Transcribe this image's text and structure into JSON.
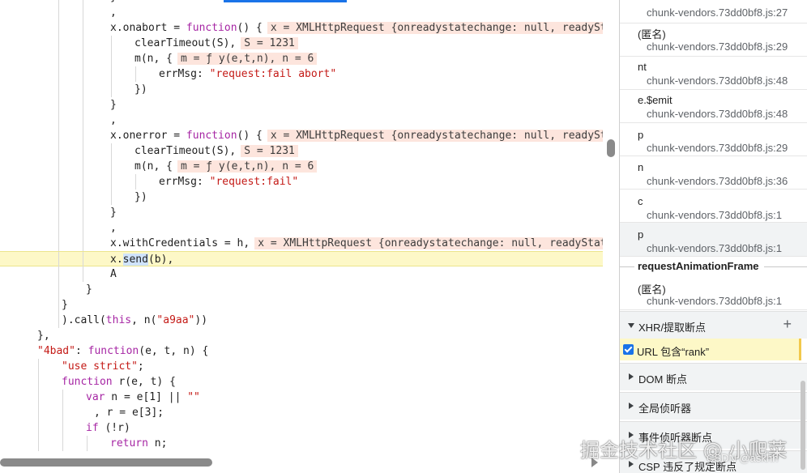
{
  "code": {
    "l0": [
      "}"
    ],
    "l1": [
      ","
    ],
    "l2": [
      "x.onabort = ",
      "function",
      "() {",
      "x = XMLHttpRequest {onreadystatechange: null, readyState"
    ],
    "l3": [
      "clearTimeout(S),",
      "S = 1231"
    ],
    "l4": [
      "m(n, {",
      "m = ƒ y(e,t,n), n = 6"
    ],
    "l5": [
      "errMsg: ",
      "\"request:fail abort\""
    ],
    "l6": [
      "})"
    ],
    "l7": [
      "}"
    ],
    "l8": [
      ","
    ],
    "l9": [
      "x.onerror = ",
      "function",
      "() {",
      "x = XMLHttpRequest {onreadystatechange: null, readyState"
    ],
    "l10": [
      "clearTimeout(S),",
      "S = 1231"
    ],
    "l11": [
      "m(n, {",
      "m = ƒ y(e,t,n), n = 6"
    ],
    "l12": [
      "errMsg: ",
      "\"request:fail\""
    ],
    "l13": [
      "})"
    ],
    "l14": [
      "}"
    ],
    "l15": [
      ","
    ],
    "l16": [
      "x.withCredentials = h,",
      "x = XMLHttpRequest {onreadystatechange: null, readyState:"
    ],
    "l17": [
      "x.",
      "send",
      "(b),"
    ],
    "l18": [
      "A"
    ],
    "l19": [
      "}"
    ],
    "l20": [
      "}"
    ],
    "l21": [
      ").call(",
      "this",
      ", n(",
      "\"a9aa\"",
      "))"
    ],
    "l22": [
      "},"
    ],
    "l23": [
      "\"4bad\"",
      ": ",
      "function",
      "(e, t, n) {"
    ],
    "l24": [
      "\"use strict\"",
      ";"
    ],
    "l25": [
      "function",
      " r(e, t) {"
    ],
    "l26": [
      "var",
      " n = e[1] || ",
      "\"\""
    ],
    "l27": [
      ", r = e[3];"
    ],
    "l28": [
      "if",
      " (!r)"
    ],
    "l29": [
      "return",
      " n;"
    ]
  },
  "call_stack": [
    {
      "name": "",
      "loc": "chunk-vendors.73dd0bf8.js:27"
    },
    {
      "name": "(匿名)",
      "loc": "chunk-vendors.73dd0bf8.js:29"
    },
    {
      "name": "nt",
      "loc": "chunk-vendors.73dd0bf8.js:48"
    },
    {
      "name": "e.$emit",
      "loc": "chunk-vendors.73dd0bf8.js:48"
    },
    {
      "name": "p",
      "loc": "chunk-vendors.73dd0bf8.js:29"
    },
    {
      "name": "n",
      "loc": "chunk-vendors.73dd0bf8.js:36"
    },
    {
      "name": "c",
      "loc": "chunk-vendors.73dd0bf8.js:1"
    },
    {
      "name": "p",
      "loc": "chunk-vendors.73dd0bf8.js:1"
    }
  ],
  "async_label": "requestAnimationFrame",
  "async_frame": {
    "name": "(匿名)",
    "loc": "chunk-vendors.73dd0bf8.js:1"
  },
  "sections": {
    "xhr": "XHR/提取断点",
    "xhr_item": "URL 包含“rank”",
    "dom": "DOM 断点",
    "global": "全局侦听器",
    "event": "事件侦听器断点",
    "csp": "CSP 违反了规定断点"
  },
  "icons": {
    "add": "plus-icon",
    "expand": "triangle-down-icon",
    "collapse": "triangle-right-icon",
    "check": "checkbox-icon"
  },
  "watermark": {
    "main": "掘金技术社区 @ 小爬菜",
    "sub": "CSDN @askhh"
  }
}
